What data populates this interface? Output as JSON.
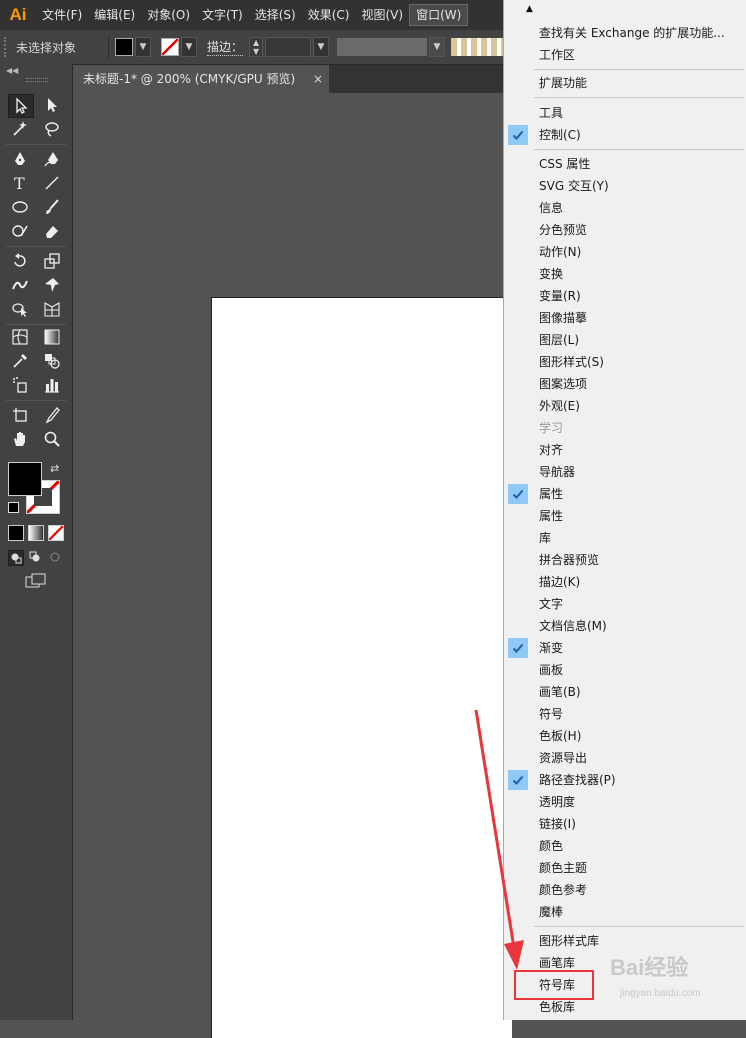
{
  "app": {
    "logo": "Ai"
  },
  "menubar": {
    "items": [
      "文件(F)",
      "编辑(E)",
      "对象(O)",
      "文字(T)",
      "选择(S)",
      "效果(C)",
      "视图(V)",
      "窗口(W)"
    ]
  },
  "controlbar": {
    "no_selection": "未选择对象",
    "stroke_label": "描边："
  },
  "tab": {
    "title": "未标题-1* @ 200% (CMYK/GPU 预览)",
    "close": "×"
  },
  "window_menu": {
    "items": [
      {
        "label": "查找有关 Exchange 的扩展功能...",
        "checked": false,
        "disabled": false
      },
      {
        "label": "工作区",
        "checked": false,
        "disabled": false
      },
      {
        "label": "扩展功能",
        "checked": false,
        "disabled": false
      },
      {
        "label": "工具",
        "checked": false,
        "disabled": false
      },
      {
        "label": "控制(C)",
        "checked": true,
        "disabled": false
      },
      {
        "label": "CSS 属性",
        "checked": false,
        "disabled": false
      },
      {
        "label": "SVG 交互(Y)",
        "checked": false,
        "disabled": false
      },
      {
        "label": "信息",
        "checked": false,
        "disabled": false
      },
      {
        "label": "分色预览",
        "checked": false,
        "disabled": false
      },
      {
        "label": "动作(N)",
        "checked": false,
        "disabled": false
      },
      {
        "label": "变换",
        "checked": false,
        "disabled": false
      },
      {
        "label": "变量(R)",
        "checked": false,
        "disabled": false
      },
      {
        "label": "图像描摹",
        "checked": false,
        "disabled": false
      },
      {
        "label": "图层(L)",
        "checked": false,
        "disabled": false
      },
      {
        "label": "图形样式(S)",
        "checked": false,
        "disabled": false
      },
      {
        "label": "图案选项",
        "checked": false,
        "disabled": false
      },
      {
        "label": "外观(E)",
        "checked": false,
        "disabled": false
      },
      {
        "label": "学习",
        "checked": false,
        "disabled": true
      },
      {
        "label": "对齐",
        "checked": false,
        "disabled": false
      },
      {
        "label": "导航器",
        "checked": false,
        "disabled": false
      },
      {
        "label": "属性",
        "checked": true,
        "disabled": false
      },
      {
        "label": "属性",
        "checked": false,
        "disabled": false
      },
      {
        "label": "库",
        "checked": false,
        "disabled": false
      },
      {
        "label": "拼合器预览",
        "checked": false,
        "disabled": false
      },
      {
        "label": "描边(K)",
        "checked": false,
        "disabled": false
      },
      {
        "label": "文字",
        "checked": false,
        "disabled": false
      },
      {
        "label": "文档信息(M)",
        "checked": false,
        "disabled": false
      },
      {
        "label": "渐变",
        "checked": true,
        "disabled": false
      },
      {
        "label": "画板",
        "checked": false,
        "disabled": false
      },
      {
        "label": "画笔(B)",
        "checked": false,
        "disabled": false
      },
      {
        "label": "符号",
        "checked": false,
        "disabled": false
      },
      {
        "label": "色板(H)",
        "checked": false,
        "disabled": false
      },
      {
        "label": "资源导出",
        "checked": false,
        "disabled": false
      },
      {
        "label": "路径查找器(P)",
        "checked": true,
        "disabled": false
      },
      {
        "label": "透明度",
        "checked": false,
        "disabled": false
      },
      {
        "label": "链接(I)",
        "checked": false,
        "disabled": false
      },
      {
        "label": "颜色",
        "checked": false,
        "disabled": false
      },
      {
        "label": "颜色主题",
        "checked": false,
        "disabled": false
      },
      {
        "label": "颜色参考",
        "checked": false,
        "disabled": false
      },
      {
        "label": "魔棒",
        "checked": false,
        "disabled": false
      },
      {
        "label": "图形样式库",
        "checked": false,
        "disabled": false
      },
      {
        "label": "画笔库",
        "checked": false,
        "disabled": false
      },
      {
        "label": "符号库",
        "checked": false,
        "disabled": false
      },
      {
        "label": "色板库",
        "checked": false,
        "disabled": false
      }
    ]
  },
  "watermark": {
    "text": "Bai经验",
    "sub": "jingyan.baidu.com"
  },
  "colors": {
    "accent_check": "#90c8f6",
    "highlight": "#e8363c",
    "logo": "#ff9a00"
  }
}
